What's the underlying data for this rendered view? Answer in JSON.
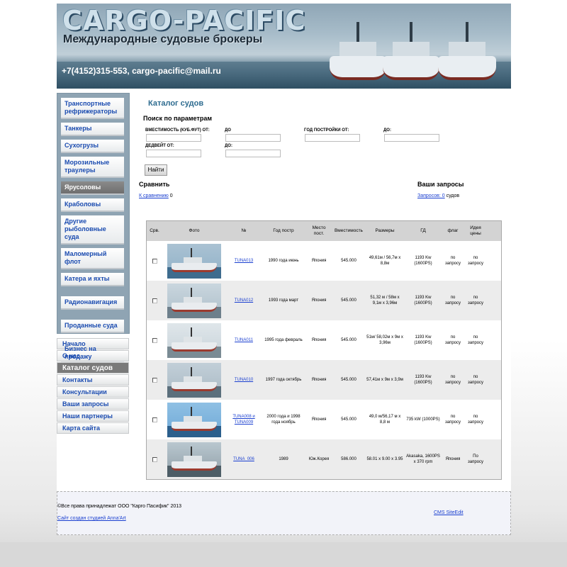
{
  "header": {
    "logo": "CARGO-PACIFIC",
    "tagline": "Международные судовые брокеры",
    "contacts": "+7(4152)315-553, cargo-pacific@mail.ru"
  },
  "category_menu": [
    {
      "label": "Транспортные рефрижераторы",
      "active": false
    },
    {
      "label": "Танкеры",
      "active": false
    },
    {
      "label": "Сухогрузы",
      "active": false
    },
    {
      "label": "Морозильные траулеры",
      "active": false
    },
    {
      "label": "Ярусоловы",
      "active": true
    },
    {
      "label": "Краболовы",
      "active": false
    },
    {
      "label": "Другие рыболовные суда",
      "active": false
    },
    {
      "label": "Маломерный флот",
      "active": false
    },
    {
      "label": "Катера и яхты",
      "active": false
    },
    {
      "label": "Радионавигация",
      "active": false
    },
    {
      "label": "Проданные суда",
      "active": false
    },
    {
      "label": "Бизнес на продажу",
      "active": false
    }
  ],
  "site_menu": [
    {
      "label": "Начало",
      "active": false
    },
    {
      "label": "О нас",
      "active": false
    },
    {
      "label": "Каталог судов",
      "active": true
    },
    {
      "label": "Контакты",
      "active": false
    },
    {
      "label": "Консультации",
      "active": false
    },
    {
      "label": "Ваши запросы",
      "active": false
    },
    {
      "label": "Наши партнеры",
      "active": false
    },
    {
      "label": "Карта сайта",
      "active": false
    }
  ],
  "content": {
    "title": "Каталог судов",
    "search": {
      "title": "Поиск по параметрам",
      "capacity_from": "ВМЕСТИМОСТЬ (КУБ.ФУТ) ОТ:",
      "capacity_to": "ДО",
      "year_from": "ГОД ПОСТРОЙКИ ОТ:",
      "year_to": "ДО:",
      "dwt_from": "ДЕДВЕЙТ ОТ:",
      "dwt_to": "ДО:",
      "button": "Найти"
    },
    "compare": {
      "title": "Сравнить",
      "link": "К сравнению",
      "count": "0"
    },
    "requests": {
      "title": "Ваши запросы",
      "link": "Запросов: 0",
      "suffix": "судов"
    }
  },
  "table": {
    "headers": {
      "chk": "Срв.",
      "photo": "Фото",
      "num": "№",
      "year": "Год постр",
      "place": "Место пост.",
      "cap": "Вместимость",
      "size": "Размеры",
      "gd": "ГД",
      "flag": "флаг",
      "price": "Идея цены"
    },
    "rows": [
      {
        "num": "TUNA013",
        "year": "1990 года июнь",
        "place": "Япония",
        "cap": "545.000",
        "size": "49,61м / 56,7м х 8,8м",
        "gd": "1193 Kw (1600PS)",
        "flag": "по запросу",
        "price": "по запросу"
      },
      {
        "num": "TUNA012",
        "year": "1993 года март",
        "place": "Япония",
        "cap": "545.000",
        "size": "51,32 м / 58м х 9,1м х 3,96м",
        "gd": "1193 Kw (1600PS)",
        "flag": "по запросу",
        "price": "по запросу"
      },
      {
        "num": "TUNA011",
        "year": "1995 года февраль",
        "place": "Япония",
        "cap": "545.000",
        "size": "51м/ 58,02м х 9м х 3,96м",
        "gd": "1193 Kw (1600PS)",
        "flag": "по запросу",
        "price": "по запросу"
      },
      {
        "num": "TUNA010",
        "year": "1997 года октябрь",
        "place": "Япония",
        "cap": "545.000",
        "size": "57,41м х 9м х 3,9м",
        "gd": "1193 Kw (1600PS)",
        "flag": "по запросу",
        "price": "по запросу"
      },
      {
        "num": "TUNA008 и TUNA009",
        "year": "2000 года и 1998 года ноябрь",
        "place": "Япония",
        "cap": "545.000",
        "size": "49,0 м/56,17 м х 8,8 м",
        "gd": "735 kW (1000PS)",
        "flag": "по запросу",
        "price": "по запросу"
      },
      {
        "num": "TUNA_006",
        "year": "1989",
        "place": "Юж.Корея",
        "cap": "586.000",
        "size": "58.01 x 9.00 x 3.95",
        "gd": "Akasaka, 1600PS x 370 rpm",
        "flag": "Япония",
        "price": "По запросу"
      }
    ]
  },
  "footer": {
    "copyright": "©Все права принадлежат ООО \"Карго Пасифик\" 2013",
    "studio": "Сайт создан студией Anna'Art",
    "cms": "CMS SiteEdit"
  }
}
